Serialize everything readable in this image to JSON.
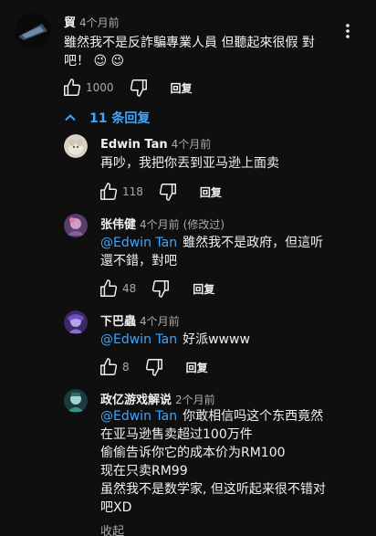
{
  "top_comment": {
    "author": "貿",
    "time": "4个月前",
    "text_line1": "雖然我不是反詐騙專業人員 但聽起來很假 對",
    "text_line2": "吧！ 😉 😉",
    "like_count": "1000",
    "reply_label": "回复",
    "menu_icon": "more-vert-icon"
  },
  "replies_toggle": {
    "label": "11 条回复",
    "icon": "chevron-up-icon"
  },
  "replies": [
    {
      "author": "Edwin Tan",
      "time": "4个月前",
      "text": "再吵，我把你丟到亚马逊上面卖",
      "like_count": "118",
      "reply_label": "回复"
    },
    {
      "author": "张伟健",
      "time": "4个月前",
      "edited": "(修改过)",
      "mention": "@Edwin Tan",
      "text_line1": "雖然我不是政府，但這听",
      "text_line2": "還不錯，對吧",
      "like_count": "48",
      "reply_label": "回复"
    },
    {
      "author": "下巴蟲",
      "time": "4个月前",
      "mention": "@Edwin Tan",
      "text": "好派wwww",
      "like_count": "8",
      "reply_label": "回复"
    },
    {
      "author": "政亿游戏解说",
      "time": "2个月前",
      "mention": "@Edwin Tan",
      "text_line1": "你敢相信吗这个东西竟然",
      "text_line2": "在亚马逊售卖超过100万件",
      "text_line3": "偷偷告诉你它的成本价为RM100",
      "text_line4": "现在只卖RM99",
      "text_line5": "虽然我不是数学家, 但这听起来很不错对",
      "text_line6": "吧XD"
    }
  ],
  "collapse_label": "收起",
  "colors": {
    "background": "#0f0f0f",
    "text": "#f1f1f1",
    "secondary": "#aaaaaa",
    "link": "#3ea6ff"
  }
}
